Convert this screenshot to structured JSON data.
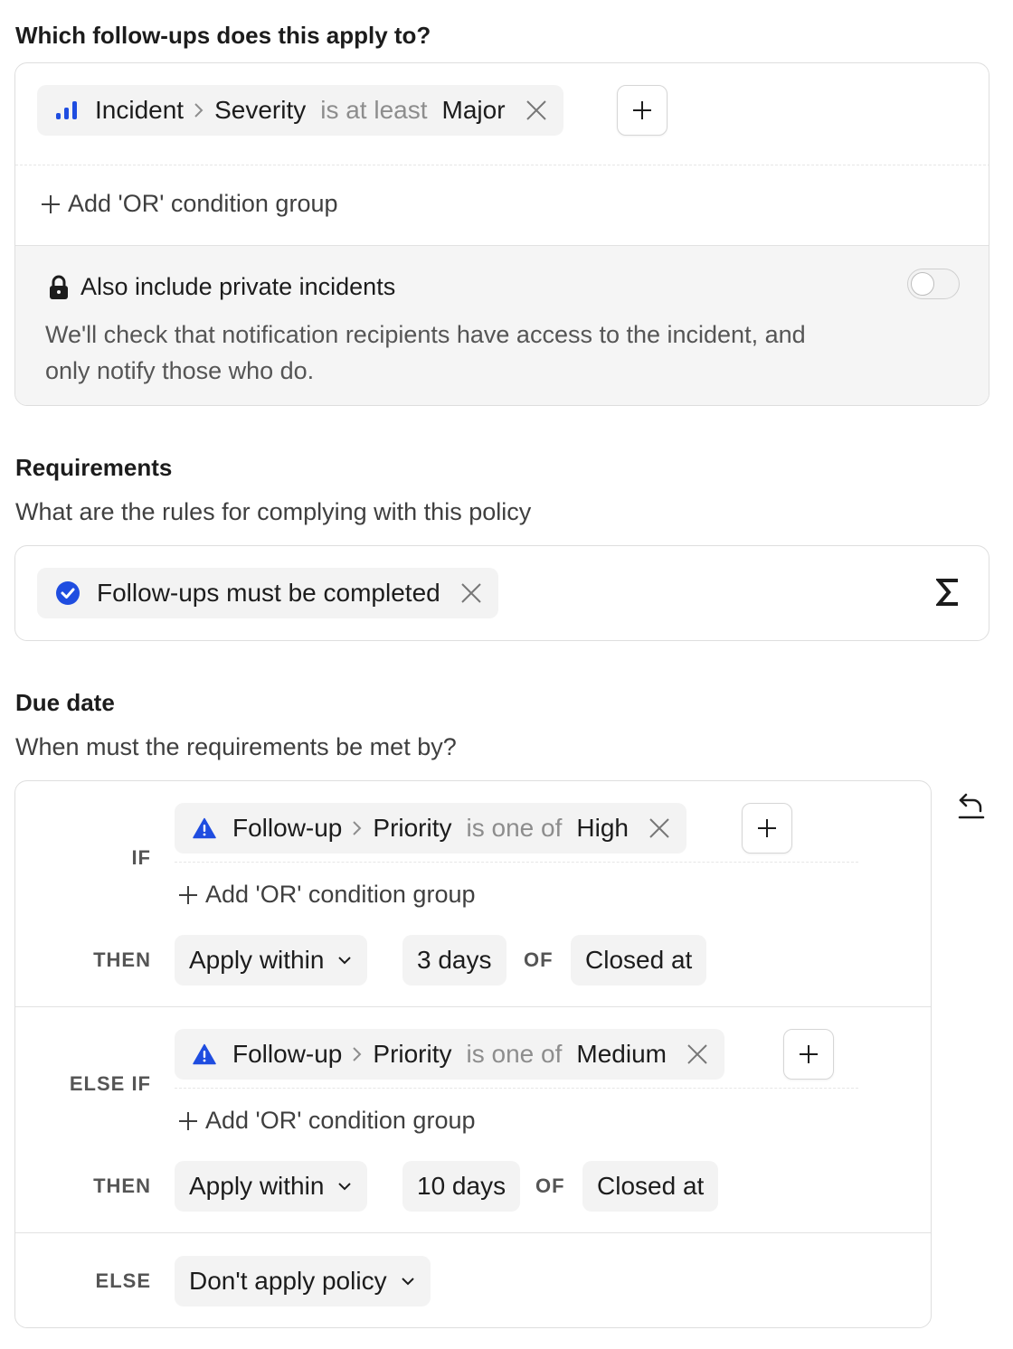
{
  "applies_section": {
    "heading": "Which follow-ups does this apply to?",
    "condition": {
      "field": "Incident",
      "subfield": "Severity",
      "operator": "is at least",
      "value": "Major"
    },
    "add_or_label": "Add 'OR' condition group",
    "private": {
      "title": "Also include private incidents",
      "description_line1": "We'll check that notification recipients have access to the incident, and",
      "description_line2": "only notify those who do.",
      "enabled": false
    }
  },
  "requirements_section": {
    "heading": "Requirements",
    "subtitle": "What are the rules for complying with this policy",
    "requirement_label": "Follow-ups must be completed"
  },
  "due_section": {
    "heading": "Due date",
    "subtitle": "When must the requirements be met by?",
    "rules": [
      {
        "keyword": "IF",
        "condition": {
          "field": "Follow-up",
          "subfield": "Priority",
          "operator": "is one of",
          "value": "High"
        },
        "add_or_label": "Add 'OR' condition group",
        "then_keyword": "THEN",
        "mode": "Apply within",
        "duration": "3 days",
        "of_keyword": "OF",
        "anchor": "Closed at"
      },
      {
        "keyword": "ELSE IF",
        "condition": {
          "field": "Follow-up",
          "subfield": "Priority",
          "operator": "is one of",
          "value": "Medium"
        },
        "add_or_label": "Add 'OR' condition group",
        "then_keyword": "THEN",
        "mode": "Apply within",
        "duration": "10 days",
        "of_keyword": "OF",
        "anchor": "Closed at"
      }
    ],
    "else": {
      "keyword": "ELSE",
      "mode": "Don't apply policy"
    }
  },
  "colors": {
    "accent_blue": "#1f4de0",
    "muted_text": "#8d8d8d",
    "card_border": "#dedede",
    "pill_bg": "#f3f3f3"
  },
  "icons": [
    "severity-bars-icon",
    "chevron-right-icon",
    "close-icon",
    "plus-icon",
    "lock-icon",
    "check-circle-icon",
    "sigma-icon",
    "warning-triangle-icon",
    "chevron-down-icon",
    "undo-icon"
  ]
}
